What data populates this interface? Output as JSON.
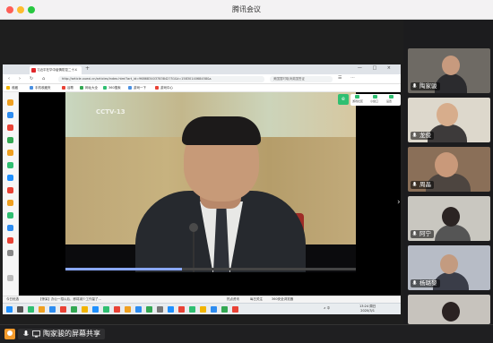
{
  "app": {
    "title": "腾讯会议"
  },
  "browser": {
    "tab_title": "习近平在华中疫情防控二十...",
    "tab_close": "×",
    "new_tab": "+",
    "window_controls": "— □ ×",
    "nav": {
      "back": "‹",
      "forward": "›",
      "reload": "↻",
      "home": "⌂"
    },
    "url": "http://article.xuexi.cn/articles/index.html?art_id=968683403783842751&t=1583014068458&s",
    "search_placeholder": "美国暂时取消英国签证",
    "bookmarks": [
      "收藏",
      "手机收藏夹",
      "谷歌",
      "网址大全",
      "360搜索",
      "游戏一下",
      "游戏中心"
    ]
  },
  "video": {
    "watermark": "CCTV-13",
    "progress": 0.4,
    "next_arrow": "›",
    "toolbox": [
      "游戏社区",
      "小窗口",
      "设置"
    ],
    "logo": "e"
  },
  "downloads": [
    "今日优选",
    "【惊呆】办公一招以后，即将减少工作量了...",
    "热点资讯",
    "每日关注",
    "360安全浏览器"
  ],
  "remote_taskbar": {
    "clock_time": "13:24 周日",
    "clock_date": "2020/3/1",
    "tray": "∧ 中"
  },
  "participants": [
    {
      "name": "陶家骏",
      "muted": false
    },
    {
      "name": "龙俊",
      "muted": false
    },
    {
      "name": "周晶",
      "muted": false
    },
    {
      "name": "阿宁",
      "muted": false
    },
    {
      "name": "杨璐黎",
      "muted": false
    },
    {
      "name": "",
      "muted": false
    }
  ],
  "bottom": {
    "share_label": "陶家骏的屏幕共享"
  },
  "colors": {
    "accent": "#2fbf71",
    "window_bg": "#2a2a2c",
    "titlebar": "#f3f2f3"
  }
}
